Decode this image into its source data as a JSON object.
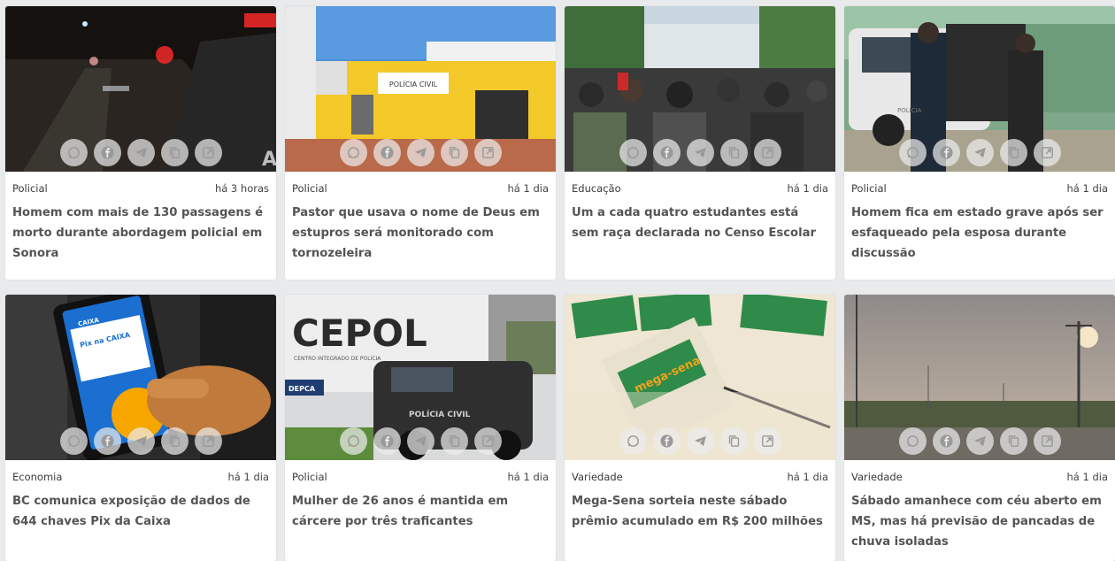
{
  "cards": [
    {
      "category": "Policial",
      "time": "há 3 horas",
      "title": "Homem com mais de 130 passagens é morto durante abordagem policial em Sonora"
    },
    {
      "category": "Policial",
      "time": "há 1 dia",
      "title": "Pastor que usava o nome de Deus em estupros será monitorado com tornozeleira"
    },
    {
      "category": "Educação",
      "time": "há 1 dia",
      "title": "Um a cada quatro estudantes está sem raça declarada no Censo Escolar"
    },
    {
      "category": "Policial",
      "time": "há 1 dia",
      "title": "Homem fica em estado grave após ser esfaqueado pela esposa durante discussão"
    },
    {
      "category": "Economia",
      "time": "há 1 dia",
      "title": "BC comunica exposição de dados de 644 chaves Pix da Caixa"
    },
    {
      "category": "Policial",
      "time": "há 1 dia",
      "title": "Mulher de 26 anos é mantida em cárcere por três traficantes"
    },
    {
      "category": "Variedade",
      "time": "há 1 dia",
      "title": "Mega-Sena sorteia neste sábado prêmio acumulado em R$ 200 milhões"
    },
    {
      "category": "Variedade",
      "time": "há 1 dia",
      "title": "Sábado amanhece com céu aberto em MS, mas há previsão de pancadas de chuva isoladas"
    }
  ],
  "share_icons": [
    "whatsapp-icon",
    "facebook-icon",
    "telegram-icon",
    "copy-icon",
    "open-external-icon"
  ],
  "image_text": {
    "card1_sign": "A",
    "card2_sign": "POLÍCIA CIVIL",
    "card4_sign": "POLÍCIA",
    "card5_brand": "CAIXA",
    "card5_pix": "Pix na CAIXA",
    "card6_building": "CEPOL",
    "card6_sub": "CENTRO INTEGRADO DE POLÍCIA",
    "card6_depca": "DEPCA",
    "card6_car": "POLÍCIA CIVIL",
    "card7_brand": "mega-sena"
  },
  "colors": {
    "card_bg": "#ffffff",
    "page_bg": "#e9eaec",
    "title": "#545454",
    "meta": "#3a3a3a",
    "share_bg": "#ebebeb"
  }
}
